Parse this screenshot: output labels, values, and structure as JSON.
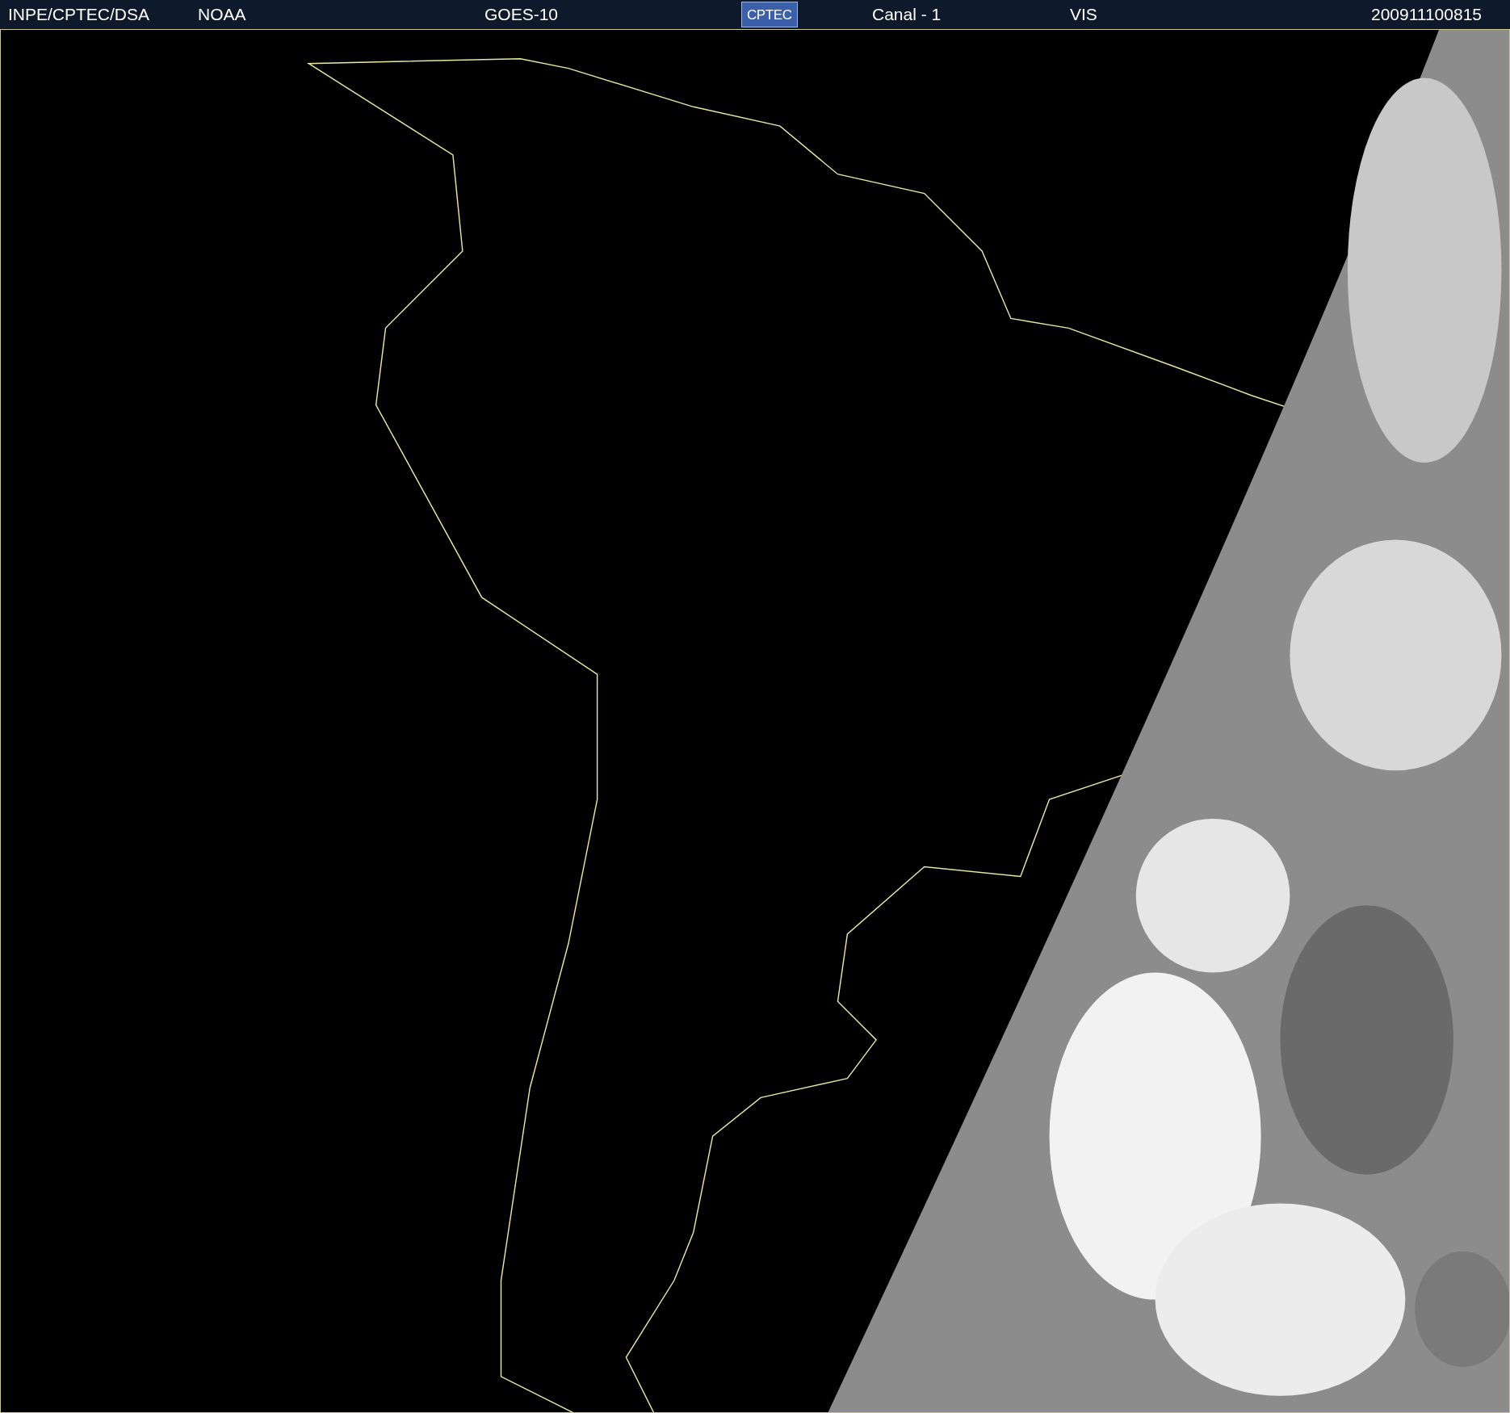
{
  "header": {
    "items": [
      {
        "kind": "text",
        "text": "INPE/CPTEC/DSA"
      },
      {
        "kind": "text",
        "text": "NOAA"
      },
      {
        "kind": "text",
        "text": "GOES-10"
      },
      {
        "kind": "logo",
        "text": "CPTEC"
      },
      {
        "kind": "text",
        "text": "Canal - 1"
      },
      {
        "kind": "text",
        "text": "VIS"
      },
      {
        "kind": "text",
        "text": "200911100815"
      }
    ]
  }
}
